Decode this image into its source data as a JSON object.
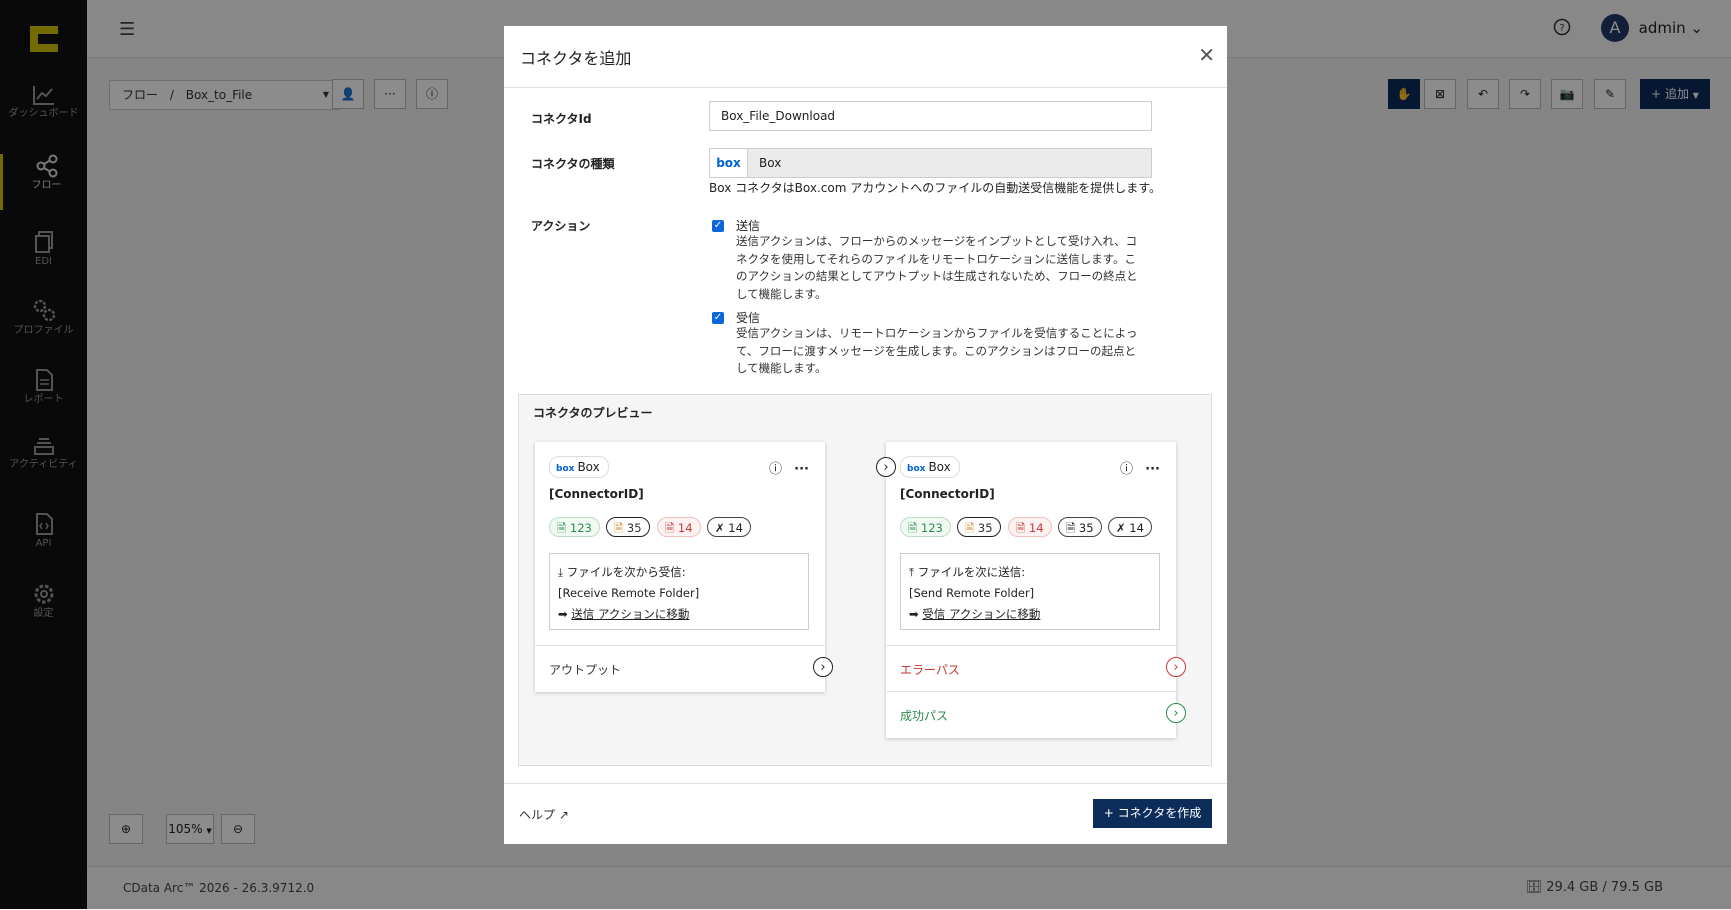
{
  "sidebar": {
    "items": [
      {
        "label": "ダッシュボード",
        "icon": "chart-line-icon"
      },
      {
        "label": "フロー",
        "icon": "share-nodes-icon"
      },
      {
        "label": "EDI",
        "icon": "copy-icon"
      },
      {
        "label": "プロファイル",
        "icon": "gears-icon"
      },
      {
        "label": "レポート",
        "icon": "file-text-icon"
      },
      {
        "label": "アクティビティ",
        "icon": "layers-icon"
      },
      {
        "label": "API",
        "icon": "file-code-icon"
      },
      {
        "label": "設定",
        "icon": "gear-icon"
      }
    ]
  },
  "header": {
    "user_initial": "A",
    "user_name": "admin"
  },
  "breadcrumb": {
    "root": "フロー",
    "separator": "/",
    "current": "Box_to_File"
  },
  "toolbar": {
    "add_label": "追加"
  },
  "zoom": {
    "level": "105%"
  },
  "footer": {
    "version": "CData Arc™ 2026 - 26.3.9712.0",
    "storage": "29.4 GB / 79.5 GB"
  },
  "modal": {
    "title": "コネクタを追加",
    "connector_id_label": "コネクタId",
    "connector_id_value": "Box_File_Download",
    "connector_type_label": "コネクタの種類",
    "connector_type_logo": "box",
    "connector_type_value": "Box",
    "connector_type_desc": "Box コネクタはBox.com アカウントへのファイルの自動送受信機能を提供します。",
    "actions_label": "アクション",
    "actions": [
      {
        "title": "送信",
        "checked": true,
        "lines": [
          "送信アクションは、フローからのメッセージをインプットとして受け入れ、コ",
          "ネクタを使用してそれらのファイルをリモートロケーションに送信します。こ",
          "のアクションの結果としてアウトプットは生成されないため、フローの終点と",
          "して機能します。"
        ]
      },
      {
        "title": "受信",
        "checked": true,
        "lines": [
          "受信アクションは、リモートロケーションからファイルを受信することによっ",
          "て、フローに渡すメッセージを生成します。このアクションはフローの起点と",
          "して機能します。"
        ]
      }
    ],
    "preview": {
      "title": "コネクタのプレビュー",
      "cards": [
        {
          "chip_logo": "box",
          "chip_label": "Box",
          "id": "[ConnectorID]",
          "badges": [
            "123",
            "35",
            "14",
            "14"
          ],
          "info_title": "ファイルを次から受信:",
          "info_folder": "[Receive Remote Folder]",
          "info_link": "送信 アクションに移動",
          "rows": [
            {
              "label": "アウトプット"
            }
          ]
        },
        {
          "chip_logo": "box",
          "chip_label": "Box",
          "id": "[ConnectorID]",
          "badges": [
            "123",
            "35",
            "14",
            "35",
            "14"
          ],
          "info_title": "ファイルを次に送信:",
          "info_folder": "[Send Remote Folder]",
          "info_link": "受信 アクションに移動",
          "rows": [
            {
              "label": "エラーパス"
            },
            {
              "label": "成功パス"
            }
          ]
        }
      ]
    },
    "help_label": "ヘルプ",
    "create_label": "コネクタを作成"
  },
  "colors": {
    "primary": "#0c2d5a",
    "accent": "#d4c400",
    "success": "#2e8b4c",
    "error": "#c93737",
    "box_blue": "#0061d5"
  }
}
